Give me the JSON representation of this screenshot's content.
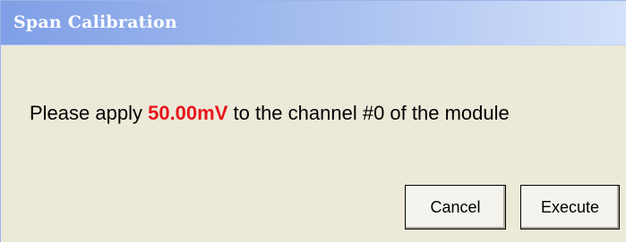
{
  "window": {
    "title": "Span Calibration"
  },
  "message": {
    "prefix": "Please apply ",
    "value": "50.00mV",
    "suffix": " to the channel #0 of the module"
  },
  "buttons": {
    "cancel_label": "Cancel",
    "execute_label": "Execute"
  },
  "colors": {
    "highlight_value": "#e8141c",
    "dialog_background": "#ece9d8",
    "titlebar_start": "#7f9fe6",
    "titlebar_end": "#d3e1f9"
  }
}
